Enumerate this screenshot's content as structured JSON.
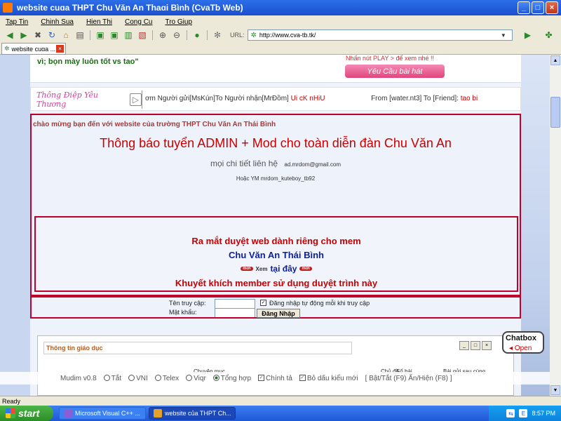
{
  "window": {
    "title": "website cuɑa THPT Chu Văn An Thaɑi Bình (CvaTb Web)",
    "controls": [
      "_",
      "□",
      "×"
    ]
  },
  "menu": [
    "Tap Tin",
    "Chinh Sua",
    "Hien Thi",
    "Cong Cu",
    "Tro Giup"
  ],
  "toolbar": {
    "url_label": "URL:",
    "url": "http://www.cva-tb.tk/"
  },
  "tab": {
    "title": "website cuɑa ...",
    "close": "×"
  },
  "page": {
    "friends_line": "vì; bọn mày luôn tốt vs tao\"",
    "play_hint": "Nhấn nút PLAY > để xem nhé !!",
    "request_button": "Yêu Cầu bài hát",
    "message_logo": "Thông Điệp Yêu Thương",
    "marquee": {
      "msg1": "ơm Người gửi[MsKún]To Người nhận[MrĐồm]",
      "msg1_red": "Ui cK nHiU",
      "msg2": "From [water.nt3] To [Friend]:",
      "msg2_red": "tao bi"
    },
    "welcome": "chào mừng bạn đến với website của trường THPT Chu Văn An Thái Bình",
    "admin_title": "Thông báo tuyển ADMIN + Mod cho toàn diễn đàn Chu Văn An",
    "contact_label": "mọi chi tiết liên hệ",
    "contact_email": "ad.mrdom@gmail.com",
    "ym": "Hoặc YM mrdom_kuteboy_tb92",
    "promo": {
      "line1": "Ra mắt duyệt web dành riêng cho mem",
      "line2": "Chu Văn An Thái Bình",
      "badge": "mới",
      "xem": "Xem",
      "here": "tại đây",
      "line4": "Khuyết khích member sử dụng duyệt trình này"
    },
    "login": {
      "username_label": "Tên truy cập:",
      "password_label": "Mật khẩu:",
      "remember_label": "Đăng nhập tự động mỗi khi truy cập",
      "remember_checked": "✓",
      "submit": "Đăng Nhập"
    },
    "lower": {
      "edu_title": "Thông tin giáo dục",
      "col_forum": "Chuyên mục",
      "col_topics": "Chủ đề",
      "col_posts": "Số bài",
      "col_last": "Bài gửi sau cùng"
    },
    "chatbox": {
      "title": "Chatbox",
      "open": "Open"
    }
  },
  "mudim": {
    "version": "Mudim v0.8",
    "options": [
      "Tắt",
      "VNI",
      "Telex",
      "Viqr",
      "Tổng hợp"
    ],
    "selected": "Tổng hợp",
    "spell": "Chính tả",
    "accent_rule": "Bỏ dấu kiểu mới",
    "shortcuts": "[ Bật/Tắt (F9) Ẩn/Hiện (F8) ]"
  },
  "status": "Ready",
  "taskbar": {
    "start": "start",
    "items": [
      "Microsoft Visual C++ ...",
      "website của THPT Ch..."
    ],
    "clock": "8:57 PM"
  }
}
